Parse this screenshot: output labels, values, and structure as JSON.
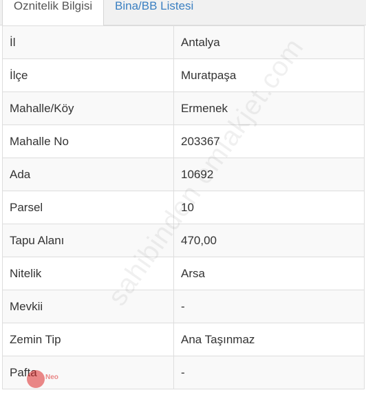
{
  "tabs": [
    {
      "label": "Oznitelik Bilgisi",
      "active": true
    },
    {
      "label": "Bina/BB Listesi",
      "active": false
    }
  ],
  "rows": [
    {
      "key": "İl",
      "value": "Antalya"
    },
    {
      "key": "İlçe",
      "value": "Muratpaşa"
    },
    {
      "key": "Mahalle/Köy",
      "value": "Ermenek"
    },
    {
      "key": "Mahalle No",
      "value": "203367"
    },
    {
      "key": "Ada",
      "value": "10692"
    },
    {
      "key": "Parsel",
      "value": "10"
    },
    {
      "key": "Tapu Alanı",
      "value": "470,00"
    },
    {
      "key": "Nitelik",
      "value": "Arsa"
    },
    {
      "key": "Mevkii",
      "value": "-"
    },
    {
      "key": "Zemin Tip",
      "value": "Ana Taşınmaz"
    },
    {
      "key": "Pafta",
      "value": "-"
    }
  ],
  "watermark": "sahibinden emlakjet.com",
  "logo_text": "Neo",
  "colors": {
    "accent": "#3a7fc1",
    "stripe": "#f9f9f9"
  }
}
